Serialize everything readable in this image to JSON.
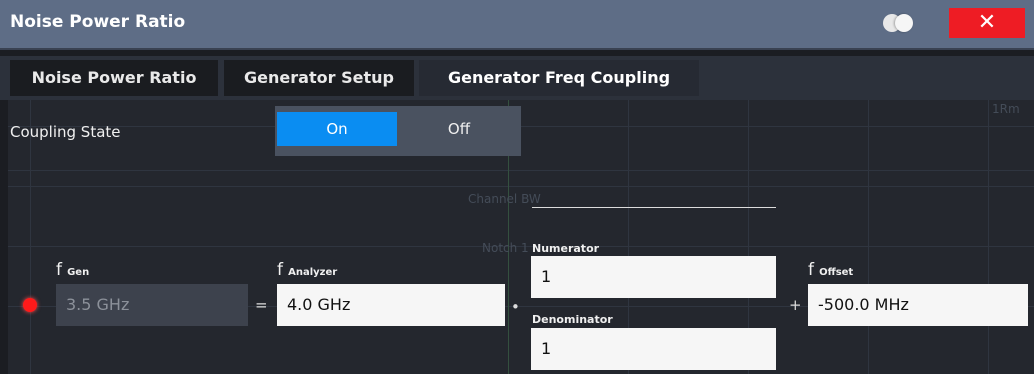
{
  "window": {
    "title": "Noise Power Ratio",
    "close_label": "✕"
  },
  "tabs": [
    {
      "label": "Noise Power Ratio",
      "active": false
    },
    {
      "label": "Generator Setup",
      "active": false
    },
    {
      "label": "Generator Freq Coupling",
      "active": true
    }
  ],
  "coupling_state": {
    "label": "Coupling State",
    "on_label": "On",
    "off_label": "Off",
    "selected": "On"
  },
  "background_text": {
    "channel_bw": "Channel BW",
    "notch": "Notch 1",
    "marker": "1Rm"
  },
  "formula": {
    "f_gen": {
      "f": "f",
      "sub": "Gen",
      "value": "3.5 GHz"
    },
    "equals": "=",
    "f_analyzer": {
      "f": "f",
      "sub": "Analyzer",
      "value": "4.0 GHz"
    },
    "dot": "•",
    "numerator": {
      "label": "Numerator",
      "value": "1"
    },
    "denominator": {
      "label": "Denominator",
      "value": "1"
    },
    "plus": "+",
    "f_offset": {
      "f": "f",
      "sub": "Offset",
      "value": "-500.0 MHz"
    }
  },
  "colors": {
    "accent": "#0a8df2",
    "close": "#ee1c24",
    "titlebar": "#5e6d86",
    "status_led": "#ff1a1a"
  }
}
